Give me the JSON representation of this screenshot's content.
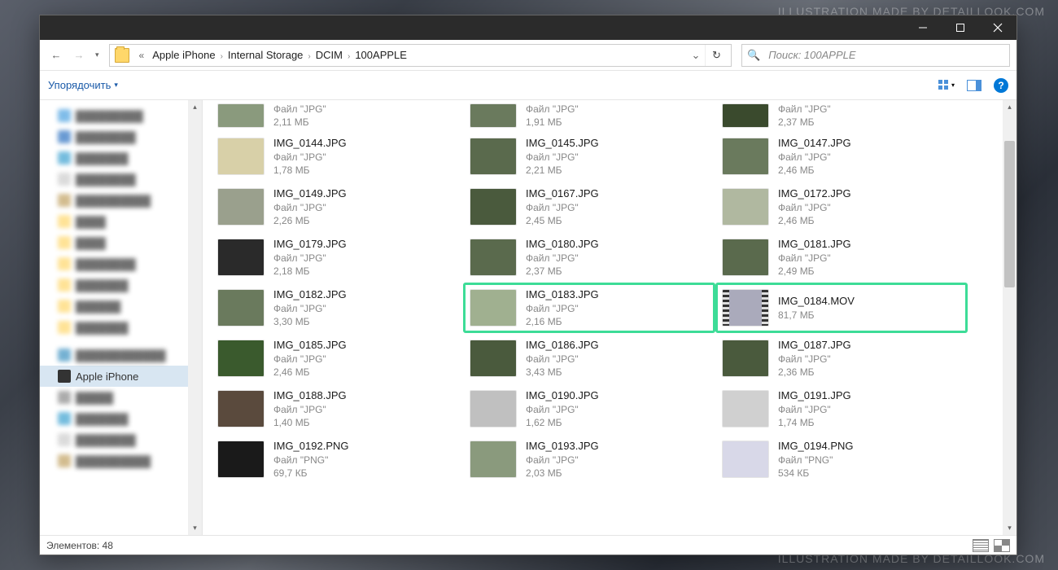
{
  "watermark_top": "ILLUSTRATION MADE BY DETAILLOOK.COM",
  "watermark_bottom": "ILLUSTRATION MADE BY DETAILLOOK.COM",
  "breadcrumb": [
    "Apple iPhone",
    "Internal Storage",
    "DCIM",
    "100APPLE"
  ],
  "search_placeholder": "Поиск: 100APPLE",
  "organize_label": "Упорядочить",
  "sidebar_selected": "Apple iPhone",
  "status_label": "Элементов:",
  "status_count": "48",
  "files": [
    {
      "name": "",
      "type": "Файл \"JPG\"",
      "size": "2,11 МБ",
      "thumb": "#8a9a7d",
      "hl": false,
      "partial": true
    },
    {
      "name": "",
      "type": "Файл \"JPG\"",
      "size": "1,91 МБ",
      "thumb": "#6a7a5d",
      "hl": false,
      "partial": true
    },
    {
      "name": "",
      "type": "Файл \"JPG\"",
      "size": "2,37 МБ",
      "thumb": "#3a4a2d",
      "hl": false,
      "partial": true
    },
    {
      "name": "IMG_0144.JPG",
      "type": "Файл \"JPG\"",
      "size": "1,78 МБ",
      "thumb": "#d8d0a8",
      "hl": false
    },
    {
      "name": "IMG_0145.JPG",
      "type": "Файл \"JPG\"",
      "size": "2,21 МБ",
      "thumb": "#5a6a4d",
      "hl": false
    },
    {
      "name": "IMG_0147.JPG",
      "type": "Файл \"JPG\"",
      "size": "2,46 МБ",
      "thumb": "#6a7a5d",
      "hl": false
    },
    {
      "name": "IMG_0149.JPG",
      "type": "Файл \"JPG\"",
      "size": "2,26 МБ",
      "thumb": "#9aa08d",
      "hl": false
    },
    {
      "name": "IMG_0167.JPG",
      "type": "Файл \"JPG\"",
      "size": "2,45 МБ",
      "thumb": "#4a5a3d",
      "hl": false
    },
    {
      "name": "IMG_0172.JPG",
      "type": "Файл \"JPG\"",
      "size": "2,46 МБ",
      "thumb": "#b0b8a0",
      "hl": false
    },
    {
      "name": "IMG_0179.JPG",
      "type": "Файл \"JPG\"",
      "size": "2,18 МБ",
      "thumb": "#2a2a2a",
      "hl": false
    },
    {
      "name": "IMG_0180.JPG",
      "type": "Файл \"JPG\"",
      "size": "2,37 МБ",
      "thumb": "#5a6a4d",
      "hl": false
    },
    {
      "name": "IMG_0181.JPG",
      "type": "Файл \"JPG\"",
      "size": "2,49 МБ",
      "thumb": "#5a6a4d",
      "hl": false
    },
    {
      "name": "IMG_0182.JPG",
      "type": "Файл \"JPG\"",
      "size": "3,30 МБ",
      "thumb": "#6a7a5d",
      "hl": false
    },
    {
      "name": "IMG_0183.JPG",
      "type": "Файл \"JPG\"",
      "size": "2,16 МБ",
      "thumb": "#a0b090",
      "hl": true
    },
    {
      "name": "IMG_0184.MOV",
      "type": "",
      "size": "81,7 МБ",
      "thumb": "mov",
      "hl": true
    },
    {
      "name": "IMG_0185.JPG",
      "type": "Файл \"JPG\"",
      "size": "2,46 МБ",
      "thumb": "#3a5a2d",
      "hl": false
    },
    {
      "name": "IMG_0186.JPG",
      "type": "Файл \"JPG\"",
      "size": "3,43 МБ",
      "thumb": "#4a5a3d",
      "hl": false
    },
    {
      "name": "IMG_0187.JPG",
      "type": "Файл \"JPG\"",
      "size": "2,36 МБ",
      "thumb": "#4a5a3d",
      "hl": false
    },
    {
      "name": "IMG_0188.JPG",
      "type": "Файл \"JPG\"",
      "size": "1,40 МБ",
      "thumb": "#5a4a3d",
      "hl": false
    },
    {
      "name": "IMG_0190.JPG",
      "type": "Файл \"JPG\"",
      "size": "1,62 МБ",
      "thumb": "#c0c0c0",
      "hl": false
    },
    {
      "name": "IMG_0191.JPG",
      "type": "Файл \"JPG\"",
      "size": "1,74 МБ",
      "thumb": "#d0d0d0",
      "hl": false
    },
    {
      "name": "IMG_0192.PNG",
      "type": "Файл \"PNG\"",
      "size": "69,7 КБ",
      "thumb": "#1a1a1a",
      "hl": false
    },
    {
      "name": "IMG_0193.JPG",
      "type": "Файл \"JPG\"",
      "size": "2,03 МБ",
      "thumb": "#8a9a7d",
      "hl": false
    },
    {
      "name": "IMG_0194.PNG",
      "type": "Файл \"PNG\"",
      "size": "534 КБ",
      "thumb": "#d8d8e8",
      "hl": false
    }
  ]
}
